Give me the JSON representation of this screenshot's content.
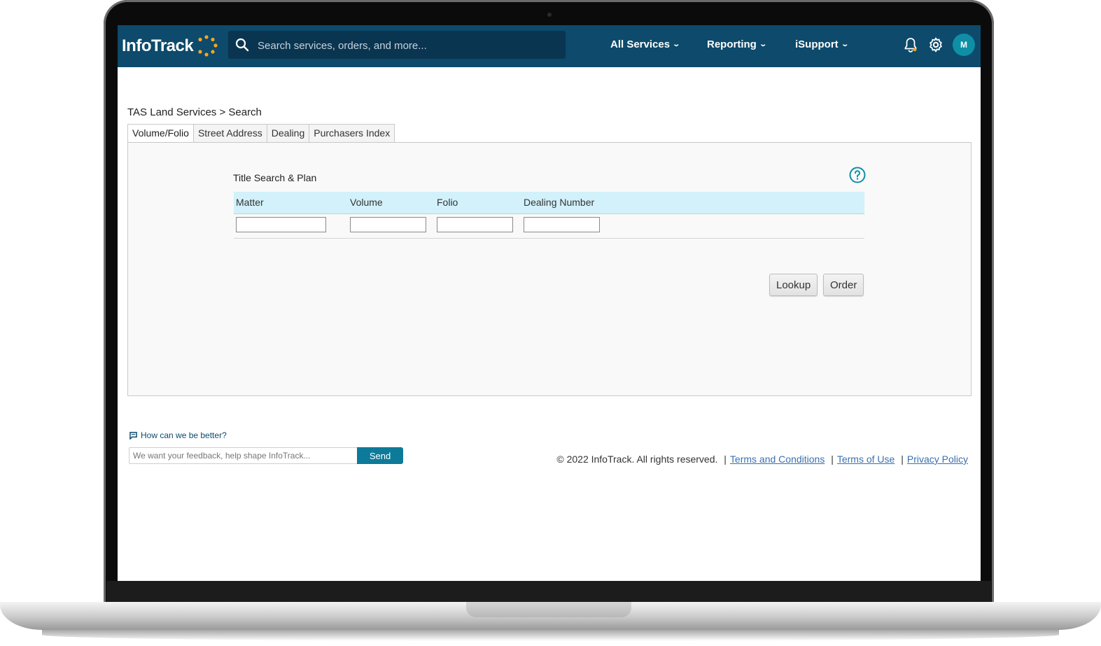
{
  "header": {
    "logo_text": "InfoTrack",
    "search_placeholder": "Search services, orders, and more...",
    "nav": [
      {
        "label": "All Services"
      },
      {
        "label": "Reporting"
      },
      {
        "label": "iSupport"
      }
    ],
    "avatar_initial": "M"
  },
  "page": {
    "breadcrumb": "TAS Land Services > Search",
    "tabs": [
      "Volume/Folio",
      "Street Address",
      "Dealing",
      "Purchasers Index"
    ],
    "active_tab": "Volume/Folio",
    "section_title": "Title Search & Plan",
    "columns": [
      "Matter",
      "Volume",
      "Folio",
      "Dealing Number"
    ],
    "buttons": {
      "lookup": "Lookup",
      "order": "Order"
    }
  },
  "footer": {
    "feedback_label": "How can we be better?",
    "feedback_placeholder": "We want your feedback, help shape InfoTrack...",
    "send_label": "Send",
    "copyright": "© 2022 InfoTrack. All rights reserved.",
    "links": [
      "Terms and Conditions",
      "Terms of Use",
      "Privacy Policy"
    ],
    "separator": "|"
  },
  "colors": {
    "header_bg": "#0d4a6b",
    "accent": "#0e8fa6",
    "grid_header": "#d2f1fa",
    "logo_sun": "#f5a623"
  },
  "icons": [
    "search-icon",
    "bell-icon",
    "gear-icon",
    "help-icon",
    "feedback-icon",
    "chevron-down-icon"
  ]
}
